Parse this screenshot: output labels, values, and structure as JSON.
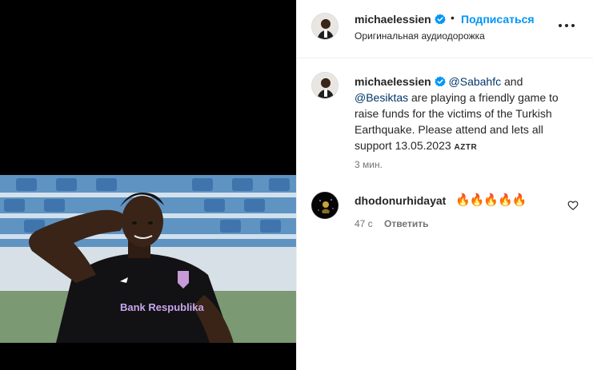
{
  "header": {
    "username": "michaelessien",
    "separator": "•",
    "follow_label": "Подписаться",
    "audio_label": "Оригинальная аудиодорожка"
  },
  "caption": {
    "username": "michaelessien",
    "mention_1": "@Sabahfc",
    "text_1": " and ",
    "mention_2": "@Besiktas",
    "text_2": " are playing a friendly game to raise funds for the victims of the Turkish Earthquake. Please attend and lets all support 13.05.2023 ",
    "tag": "AZTR",
    "time": "3 мин."
  },
  "comment": {
    "username": "dhodonurhidayat",
    "text": "🔥🔥🔥🔥🔥",
    "time": "47 с",
    "reply_label": "Ответить"
  },
  "colors": {
    "link_blue": "#0095f6",
    "mention_blue": "#00376b",
    "verified_blue": "#0095f6",
    "secondary_text": "#737373"
  },
  "icons": {
    "verified": "verified-badge-icon",
    "more": "more-options-icon",
    "like": "heart-icon"
  }
}
